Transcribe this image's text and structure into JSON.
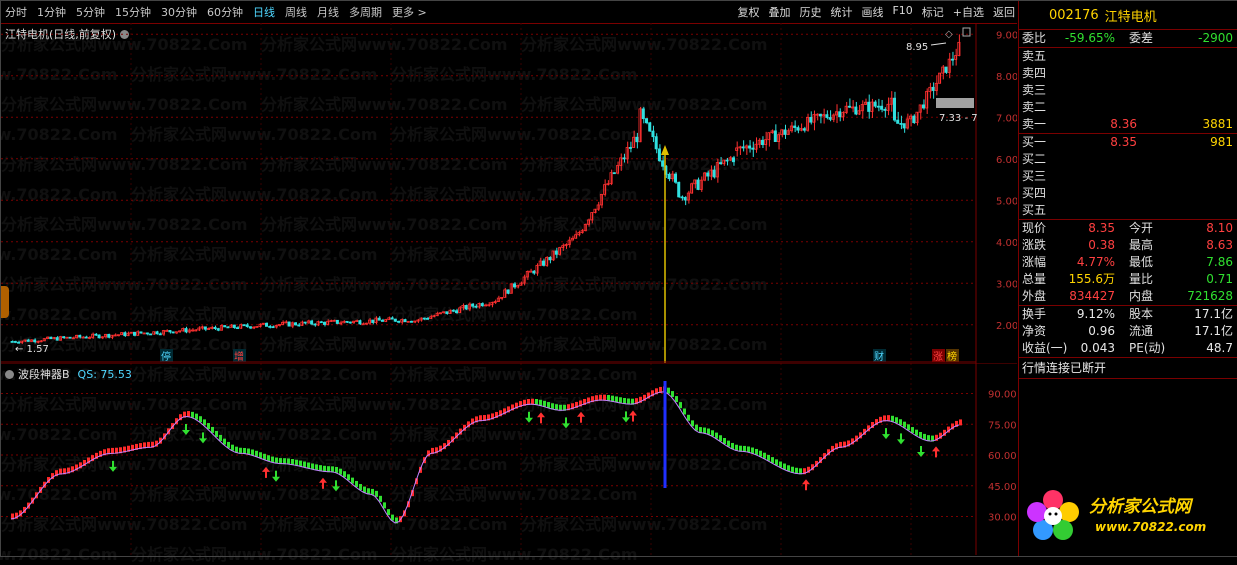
{
  "toolbar": {
    "periods": [
      "分时",
      "1分钟",
      "5分钟",
      "15分钟",
      "30分钟",
      "60分钟",
      "日线",
      "周线",
      "月线",
      "多周期",
      "更多 >"
    ],
    "active_period": "日线",
    "actions": [
      "复权",
      "叠加",
      "历史",
      "统计",
      "画线",
      "F10",
      "标记",
      "+自选",
      "返回"
    ]
  },
  "chart": {
    "title": "江特电机(日线,前复权)",
    "price_axis": [
      "9.00",
      "8.00",
      "7.00",
      "6.00",
      "5.00",
      "4.00",
      "3.00",
      "2.00"
    ],
    "high_label": "8.95",
    "low_label": "1.57",
    "range_label": "7.33 - 7",
    "markers": [
      {
        "text": "停",
        "color": "#4fd7ff"
      },
      {
        "text": "增",
        "color": "#ff4040"
      },
      {
        "text": "财",
        "color": "#4fd7ff"
      },
      {
        "text": "涨",
        "color": "#ff4040"
      },
      {
        "text": "榜",
        "color": "#ffd400"
      }
    ]
  },
  "indicator": {
    "name": "波段神器B",
    "qs_label": "QS: 75.53",
    "axis": [
      "90.00",
      "75.00",
      "60.00",
      "45.00",
      "30.00"
    ]
  },
  "panel": {
    "code": "002176",
    "name": "江特电机",
    "weibi_label": "委比",
    "weibi_value": "-59.65%",
    "weicha_label": "委差",
    "weicha_value": "-2900",
    "sell": [
      {
        "label": "卖五",
        "price": "",
        "vol": ""
      },
      {
        "label": "卖四",
        "price": "",
        "vol": ""
      },
      {
        "label": "卖三",
        "price": "",
        "vol": ""
      },
      {
        "label": "卖二",
        "price": "",
        "vol": ""
      },
      {
        "label": "卖一",
        "price": "8.36",
        "vol": "3881"
      }
    ],
    "buy": [
      {
        "label": "买一",
        "price": "8.35",
        "vol": "981"
      },
      {
        "label": "买二",
        "price": "",
        "vol": ""
      },
      {
        "label": "买三",
        "price": "",
        "vol": ""
      },
      {
        "label": "买四",
        "price": "",
        "vol": ""
      },
      {
        "label": "买五",
        "price": "",
        "vol": ""
      }
    ],
    "stats": [
      {
        "l1": "现价",
        "v1": "8.35",
        "c1": "red",
        "l2": "今开",
        "v2": "8.10",
        "c2": "red"
      },
      {
        "l1": "涨跌",
        "v1": "0.38",
        "c1": "red",
        "l2": "最高",
        "v2": "8.63",
        "c2": "red"
      },
      {
        "l1": "涨幅",
        "v1": "4.77%",
        "c1": "red",
        "l2": "最低",
        "v2": "7.86",
        "c2": "green"
      },
      {
        "l1": "总量",
        "v1": "155.6万",
        "c1": "yellow",
        "l2": "量比",
        "v2": "0.71",
        "c2": "green"
      },
      {
        "l1": "外盘",
        "v1": "834427",
        "c1": "red",
        "l2": "内盘",
        "v2": "721628",
        "c2": "green"
      }
    ],
    "stats2": [
      {
        "l1": "换手",
        "v1": "9.12%",
        "l2": "股本",
        "v2": "17.1亿"
      },
      {
        "l1": "净资",
        "v1": "0.96",
        "l2": "流通",
        "v2": "17.1亿"
      },
      {
        "l1": "收益(一)",
        "v1": "0.043",
        "l2": "PE(动)",
        "v2": "48.7"
      }
    ],
    "status": "行情连接已断开"
  },
  "logo": {
    "text": "分析家公式网",
    "url": "www.70822.com"
  },
  "watermark": "分析家公式网www.70822.Com",
  "colors": {
    "up": "#ff3030",
    "down": "#30e0e0",
    "green": "#30e030",
    "accent": "#4fd7ff",
    "grid": "#7a0000"
  }
}
